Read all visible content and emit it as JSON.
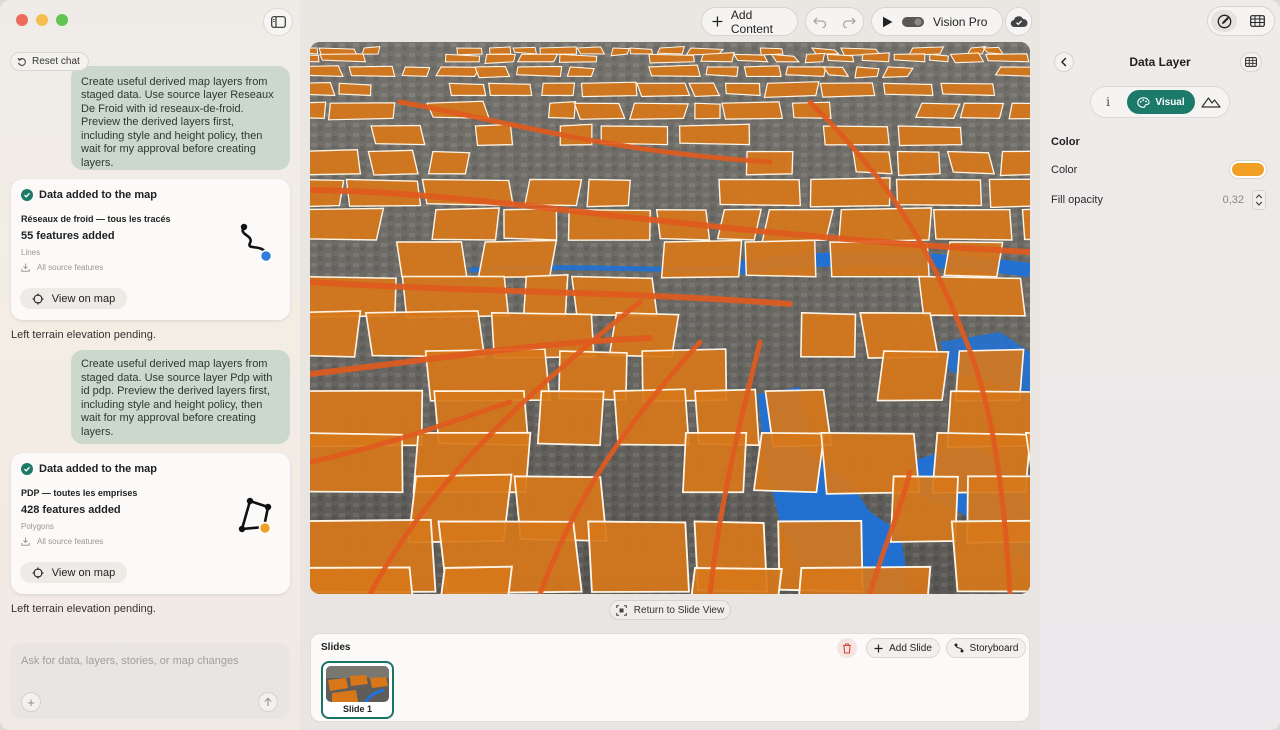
{
  "chat": {
    "reset_label": "Reset chat",
    "messages": [
      {
        "role": "user",
        "lines": [
          "Create useful derived map layers from",
          "staged data. Use source layer Reseaux",
          "De Froid with id reseaux-de-froid.",
          "Preview the derived layers first,",
          "including style and height policy, then",
          "wait for my approval before creating",
          "layers."
        ]
      },
      {
        "role": "assistant",
        "card_title": "Data added to the map",
        "layer_name": "Réseaux de froid — tous les tracés",
        "count": "55 features added",
        "geometry": "Lines",
        "source": "All source features",
        "action": "View on map",
        "accent": "#2f7de0"
      },
      {
        "role": "assistant_text",
        "text": "Left terrain elevation pending."
      },
      {
        "role": "user",
        "lines": [
          "Create useful derived map layers from",
          "staged data. Use source layer Pdp with",
          "id pdp. Preview the derived layers first,",
          "including style and height policy, then",
          "wait for my approval before creating",
          "layers."
        ]
      },
      {
        "role": "assistant",
        "card_title": "Data added to the map",
        "layer_name": "PDP — toutes les emprises",
        "count": "428 features added",
        "geometry": "Polygons",
        "source": "All source features",
        "action": "View on map",
        "accent": "#f0a024"
      },
      {
        "role": "assistant_text",
        "text": "Left terrain elevation pending."
      }
    ],
    "composer_placeholder": "Ask for data, layers, stories, or map changes"
  },
  "toolbar": {
    "add_content": "Add Content",
    "vision_pro": "Vision Pro"
  },
  "map": {
    "return_label": "Return to Slide View",
    "fill_color": "#d7771a",
    "line_color": "#e05a1e",
    "river_color": "#1f72d8"
  },
  "slides": {
    "title": "Slides",
    "add_label": "Add Slide",
    "storyboard_label": "Storyboard",
    "items": [
      {
        "label": "Slide 1"
      }
    ]
  },
  "inspector": {
    "title": "Data Layer",
    "tabs": {
      "info": "i",
      "visual": "Visual"
    },
    "section": "Color",
    "color_label": "Color",
    "color_value": "#f0a024",
    "opacity_label": "Fill opacity",
    "opacity_value": "0,32"
  }
}
